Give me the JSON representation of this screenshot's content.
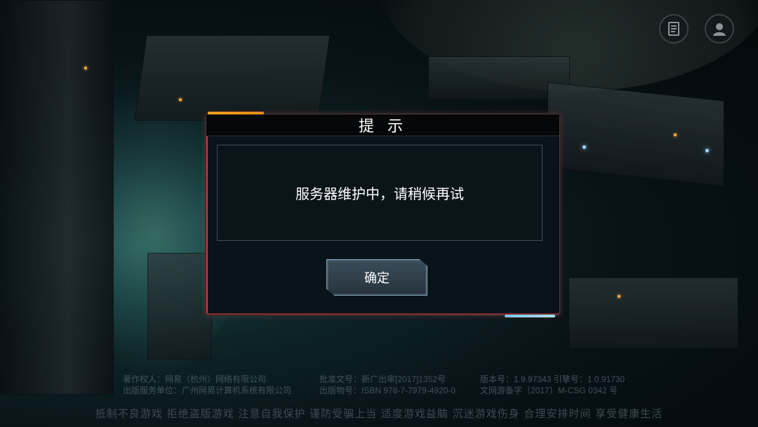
{
  "dialog": {
    "title": "提 示",
    "message": "服务器维护中，请稍候再试",
    "confirm_label": "确定"
  },
  "legal": {
    "left_line1": "著作权人：网易（杭州）网络有限公司",
    "left_line2": "出版服务单位：广州网易计算机系统有限公司",
    "mid_line1": "批准文号：新广出审[2017]1352号",
    "mid_line2": "出版物号：ISBN 978-7-7979-4920-0",
    "right_line1": "版本号：1.9.97343 引擎号：1.0.91730",
    "right_line2": "文网游备字〔2017〕M-CSG 0342 号"
  },
  "slogan": "抵制不良游戏 拒绝盗版游戏 注意自我保护 谨防受骗上当 适度游戏益脑 沉迷游戏伤身 合理安排时间 享受健康生活",
  "icons": {
    "notice": "notice-icon",
    "account": "account-icon"
  },
  "colors": {
    "accent_orange": "#f2a11f",
    "accent_blue": "#7cc6e6",
    "border_red": "#c8353a"
  }
}
